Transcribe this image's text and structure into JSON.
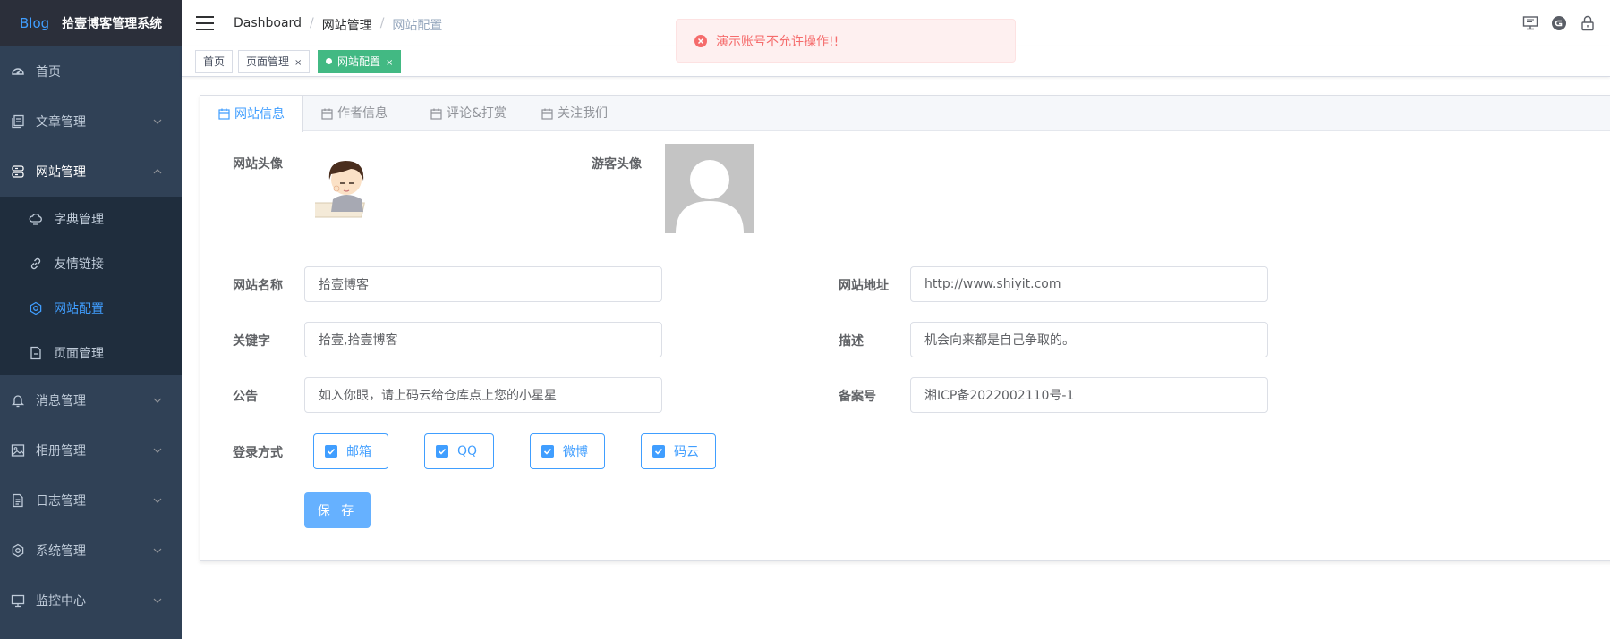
{
  "sidebar": {
    "logo_prefix": "Blog",
    "logo_title": "拾壹博客管理系统",
    "items": [
      {
        "label": "首页",
        "icon": "dashboard-icon"
      },
      {
        "label": "文章管理",
        "icon": "document-copy-icon"
      },
      {
        "label": "网站管理",
        "icon": "server-icon"
      },
      {
        "label": "消息管理",
        "icon": "bell-icon"
      },
      {
        "label": "相册管理",
        "icon": "picture-icon"
      },
      {
        "label": "日志管理",
        "icon": "file-icon"
      },
      {
        "label": "系统管理",
        "icon": "setting-icon"
      },
      {
        "label": "监控中心",
        "icon": "monitor-icon"
      }
    ],
    "sub_items": [
      {
        "label": "字典管理",
        "icon": "cloud-icon"
      },
      {
        "label": "友情链接",
        "icon": "link-icon"
      },
      {
        "label": "网站配置",
        "icon": "gear-icon"
      },
      {
        "label": "页面管理",
        "icon": "page-icon"
      }
    ]
  },
  "header": {
    "breadcrumb": [
      "Dashboard",
      "网站管理",
      "网站配置"
    ],
    "separator": "/"
  },
  "tags": [
    {
      "label": "首页"
    },
    {
      "label": "页面管理",
      "close": "×"
    },
    {
      "label": "网站配置",
      "close": "×"
    }
  ],
  "message": {
    "text": "演示账号不允许操作!!",
    "color": "#f56c6c"
  },
  "tabs": [
    "网站信息",
    "作者信息",
    "评论&打赏",
    "关注我们"
  ],
  "form": {
    "logo_label": "网站头像",
    "guest_avatar_label": "游客头像",
    "name_label": "网站名称",
    "name_value": "拾壹博客",
    "url_label": "网站地址",
    "url_value": "http://www.shiyit.com",
    "keywords_label": "关键字",
    "keywords_value": "拾壹,拾壹博客",
    "desc_label": "描述",
    "desc_value": "机会向来都是自己争取的。",
    "notice_label": "公告",
    "notice_value": "如入你眼，请上码云给仓库点上您的小星星",
    "icp_label": "备案号",
    "icp_value": "湘ICP备2022002110号-1",
    "login_label": "登录方式",
    "login_options": [
      "邮箱",
      "QQ",
      "微博",
      "码云"
    ],
    "save_label": "保 存"
  },
  "colors": {
    "primary": "#409eff",
    "sidebar": "#304156",
    "tag_active": "#42b983"
  }
}
